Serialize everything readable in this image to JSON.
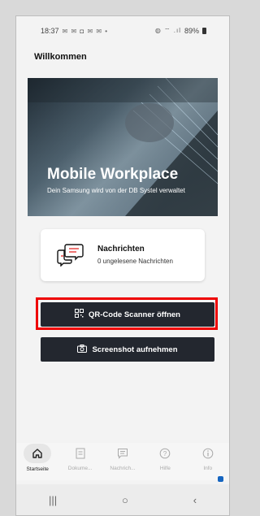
{
  "status_bar": {
    "time": "18:37",
    "battery": "89%"
  },
  "page": {
    "title": "Willkommen"
  },
  "hero": {
    "title": "Mobile Workplace",
    "subtitle": "Dein Samsung wird von der DB Systel verwaltet"
  },
  "messages_card": {
    "title": "Nachrichten",
    "subtitle": "0 ungelesene Nachrichten",
    "icon": "chat-bubbles-icon"
  },
  "buttons": {
    "qr_scanner": {
      "label": "QR-Code Scanner öffnen",
      "icon": "qr-code-icon"
    },
    "screenshot": {
      "label": "Screenshot aufnehmen",
      "icon": "camera-icon"
    }
  },
  "bottom_nav": {
    "items": [
      {
        "label": "Startseite",
        "icon": "home-icon",
        "active": true
      },
      {
        "label": "Dokume...",
        "icon": "document-icon",
        "active": false
      },
      {
        "label": "Nachrich...",
        "icon": "message-icon",
        "active": false
      },
      {
        "label": "Hilfe",
        "icon": "help-icon",
        "active": false
      },
      {
        "label": "Info",
        "icon": "info-icon",
        "active": false
      }
    ]
  },
  "system_nav": {
    "recents": "|||",
    "home": "○",
    "back": "‹"
  },
  "colors": {
    "button_bg": "#23272f",
    "highlight": "#e00000",
    "badge": "#1565c0"
  }
}
